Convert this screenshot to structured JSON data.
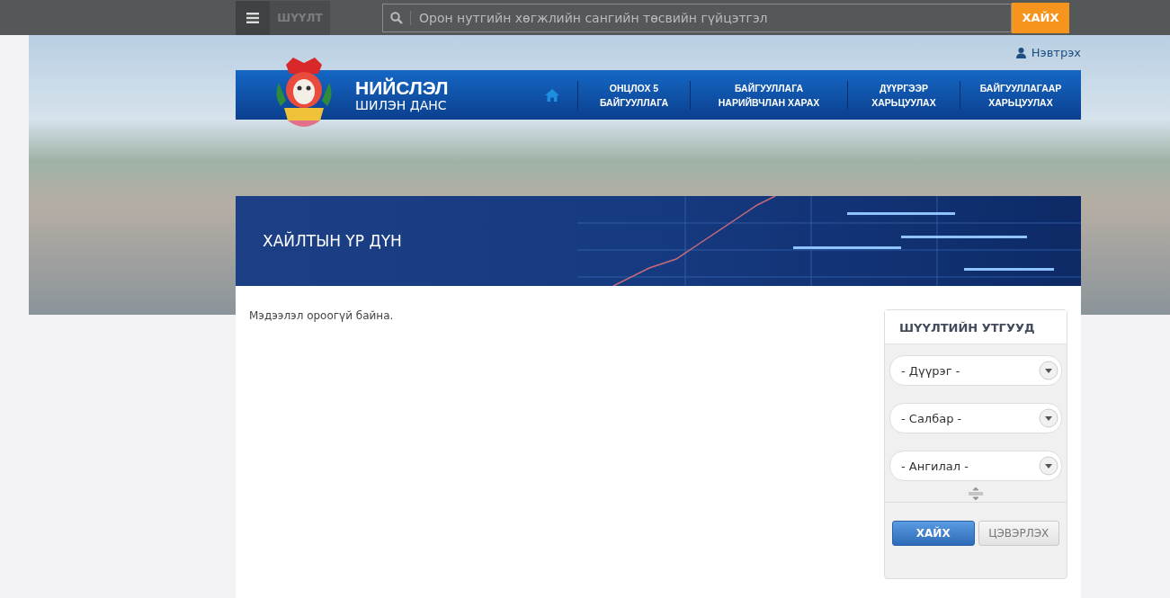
{
  "topbar": {
    "filter_label": "ШҮҮЛТ",
    "search": {
      "placeholder": "Орон нутгийн хөгжлийн сангийн төсвийн гүйцэтгэл"
    },
    "search_button": "ХАЙХ"
  },
  "login": "Нэвтрэх",
  "brand": {
    "title": "НИЙСЛЭЛ",
    "subtitle": "ШИЛЭН ДАНС"
  },
  "nav": [
    {
      "lines": [
        "ОНЦЛОХ 5",
        "БАЙГУУЛЛАГА"
      ]
    },
    {
      "lines": [
        "БАЙГУУЛЛАГА",
        "НАРИЙВЧЛАН ХАРАХ"
      ]
    },
    {
      "lines": [
        "ДҮҮРГЭЭР",
        "ХАРЬЦУУЛАХ"
      ]
    },
    {
      "lines": [
        "БАЙГУУЛЛАГААР",
        "ХАРЬЦУУЛАХ"
      ]
    }
  ],
  "page_title": "ХАЙЛТЫН ҮР ДҮН",
  "message": "Мэдээлэл ороогүй байна.",
  "filter": {
    "title": "ШҮҮЛТИЙН УТГУУД",
    "selects": [
      {
        "value": "- Дүүрэг -"
      },
      {
        "value": "- Салбар -"
      },
      {
        "value": "- Ангилал -"
      }
    ],
    "buttons": [
      {
        "label": "ХАЙХ",
        "kind": "primary"
      },
      {
        "label": "ЦЭВЭРЛЭХ",
        "kind": "secondary"
      }
    ]
  }
}
